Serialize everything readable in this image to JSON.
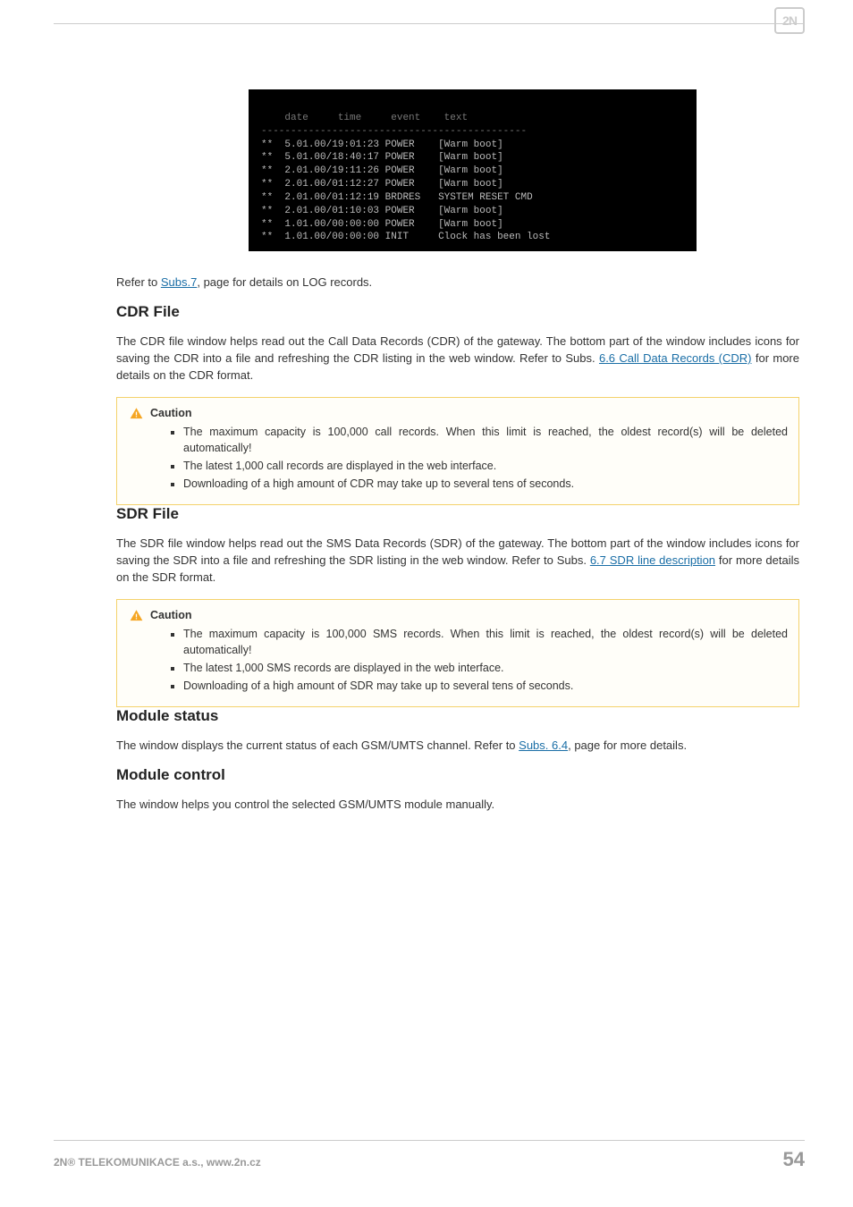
{
  "logo": "2N",
  "log_box": {
    "hdr_date": "date",
    "hdr_time": "time",
    "hdr_event": "event",
    "hdr_text": "text",
    "sep": "---------------------------------------------",
    "rows": [
      {
        "p": "**",
        "d": " 5.01.00/19:01:23",
        "e": "POWER ",
        "t": "[Warm boot]"
      },
      {
        "p": "**",
        "d": " 5.01.00/18:40:17",
        "e": "POWER ",
        "t": "[Warm boot]"
      },
      {
        "p": "**",
        "d": " 2.01.00/19:11:26",
        "e": "POWER ",
        "t": "[Warm boot]"
      },
      {
        "p": "**",
        "d": " 2.01.00/01:12:27",
        "e": "POWER ",
        "t": "[Warm boot]"
      },
      {
        "p": "**",
        "d": " 2.01.00/01:12:19",
        "e": "BRDRES",
        "t": "SYSTEM RESET CMD"
      },
      {
        "p": "**",
        "d": " 2.01.00/01:10:03",
        "e": "POWER ",
        "t": "[Warm boot]"
      },
      {
        "p": "**",
        "d": " 1.01.00/00:00:00",
        "e": "POWER ",
        "t": "[Warm boot]"
      },
      {
        "p": "**",
        "d": " 1.01.00/00:00:00",
        "e": "INIT  ",
        "t": "Clock has been lost"
      }
    ]
  },
  "refer_subs7_pre": "Refer to ",
  "refer_subs7_link": "Subs.7",
  "refer_subs7_post": ", page for details on LOG records.",
  "cdr": {
    "title": "CDR File",
    "p_pre": "The CDR file window helps read out the Call Data Records (CDR) of the gateway. The bottom part of the window includes icons for saving the CDR into a file and refreshing the CDR listing in the web window. Refer to Subs. ",
    "p_link": "6.6 Call Data Records (CDR)",
    "p_post": " for more details on the CDR format.",
    "caution_title": "Caution",
    "bullets": [
      "The maximum capacity is 100,000 call records. When this limit is reached, the oldest record(s) will be deleted automatically!",
      "The latest 1,000 call records are displayed in the web interface.",
      "Downloading of a high amount of CDR may take up to several tens of seconds."
    ]
  },
  "sdr": {
    "title": "SDR File",
    "p_pre": "The SDR file window helps read out the SMS Data Records (SDR) of the gateway. The bottom part of the window includes icons for saving the SDR into a file and refreshing the SDR listing in the web window. Refer to Subs. ",
    "p_link": "6.7 SDR line description",
    "p_post": " for more details on the SDR format.",
    "caution_title": "Caution",
    "bullets": [
      "The maximum capacity is 100,000 SMS records. When this limit is reached, the oldest record(s) will be deleted automatically!",
      "The latest 1,000 SMS records are displayed in the web interface.",
      "Downloading of a high amount of SDR may take up to several tens of seconds."
    ]
  },
  "modstat": {
    "title": "Module status",
    "p_pre": "The window displays the current status of each GSM/UMTS channel. Refer to ",
    "p_link": "Subs. 6.4",
    "p_post": ", page for more details."
  },
  "modctrl": {
    "title": "Module control",
    "p": "The window helps you control the selected GSM/UMTS module manually."
  },
  "footer": {
    "left": "2N® TELEKOMUNIKACE a.s., www.2n.cz",
    "right": "54"
  }
}
